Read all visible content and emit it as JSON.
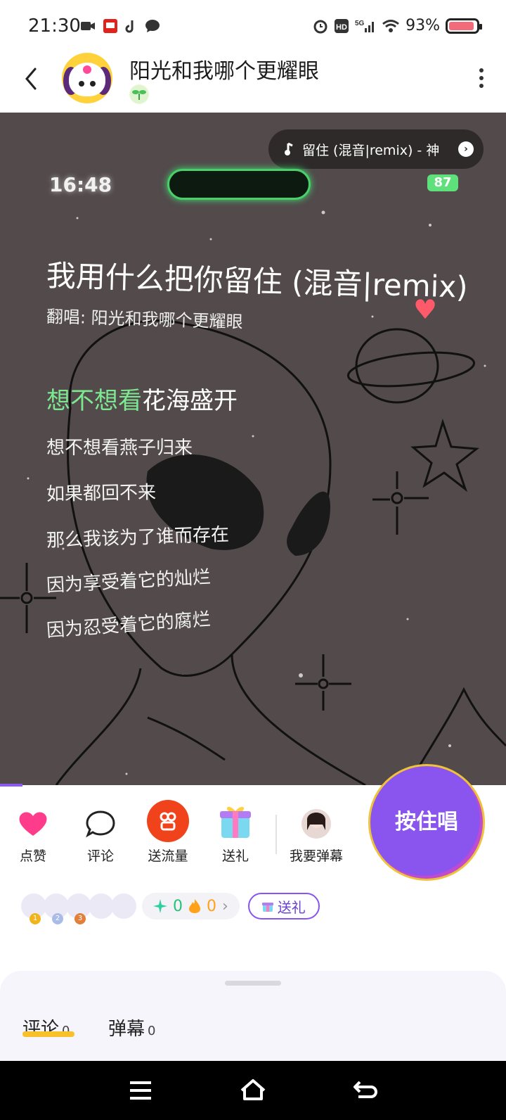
{
  "status_bar": {
    "time": "21:30",
    "battery_percent": "93%",
    "battery_level": 0.93,
    "icons": [
      "video-icon",
      "app-badge-icon",
      "tiktok-icon",
      "message-icon",
      "alarm-icon",
      "hd-icon",
      "5g-signal-icon",
      "wifi-icon",
      "battery-icon"
    ]
  },
  "header": {
    "title": "阳光和我哪个更耀眼"
  },
  "video": {
    "music_pill_text": "留住 (混音|remix) - 神",
    "phone_time": "16:48",
    "phone_battery": "87",
    "song_title": "我用什么把你留住 (混音|remix)",
    "cover_line": "翻唱: 阳光和我哪个更耀眼",
    "current_lyric_sung": "想不想看",
    "current_lyric_rest": "花海盛开",
    "lyrics": [
      "想不想看燕子归来",
      "如果都回不来",
      "那么我该为了谁而存在",
      "因为享受着它的灿烂",
      "因为忍受着它的腐烂"
    ],
    "progress": 0.045
  },
  "actions": {
    "like": "点赞",
    "comment": "评论",
    "boost": "送流量",
    "gift": "送礼",
    "danmaku": "我要弹幕",
    "sing": "按住唱"
  },
  "stats": {
    "sparkle_count": "0",
    "fire_count": "0",
    "gift_label": "送礼",
    "ranks": [
      "1",
      "2",
      "3"
    ]
  },
  "sheet": {
    "comments_label": "评论",
    "comments_count": "0",
    "danmaku_label": "弹幕",
    "danmaku_count": "0"
  },
  "colors": {
    "accent_purple": "#8a55ef",
    "like_pink": "#ff3b8b",
    "boost_red": "#f0431c",
    "lyric_green": "#7ce890"
  }
}
